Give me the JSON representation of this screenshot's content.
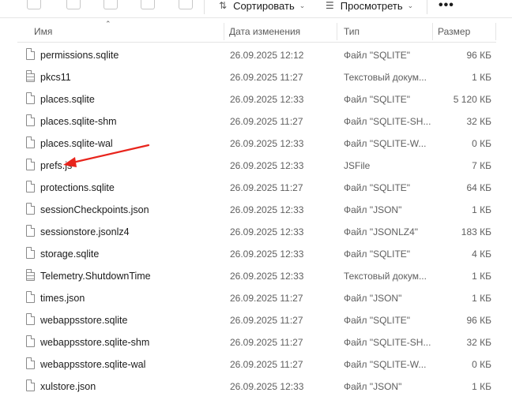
{
  "toolbar": {
    "sort_label": "Сортировать",
    "view_label": "Просмотреть",
    "more_label": "•••"
  },
  "columns": {
    "name": "Имя",
    "date": "Дата изменения",
    "type": "Тип",
    "size": "Размер"
  },
  "files": [
    {
      "name": "permissions.sqlite",
      "date": "26.09.2025 12:12",
      "type": "Файл \"SQLITE\"",
      "size": "96 КБ",
      "icon": "file-icon"
    },
    {
      "name": "pkcs11",
      "date": "26.09.2025 11:27",
      "type": "Текстовый докум...",
      "size": "1 КБ",
      "icon": "text-file-icon"
    },
    {
      "name": "places.sqlite",
      "date": "26.09.2025 12:33",
      "type": "Файл \"SQLITE\"",
      "size": "5 120 КБ",
      "icon": "file-icon"
    },
    {
      "name": "places.sqlite-shm",
      "date": "26.09.2025 11:27",
      "type": "Файл \"SQLITE-SH...",
      "size": "32 КБ",
      "icon": "file-icon"
    },
    {
      "name": "places.sqlite-wal",
      "date": "26.09.2025 12:33",
      "type": "Файл \"SQLITE-W...",
      "size": "0 КБ",
      "icon": "file-icon"
    },
    {
      "name": "prefs.js",
      "date": "26.09.2025 12:33",
      "type": "JSFile",
      "size": "7 КБ",
      "icon": "file-icon"
    },
    {
      "name": "protections.sqlite",
      "date": "26.09.2025 11:27",
      "type": "Файл \"SQLITE\"",
      "size": "64 КБ",
      "icon": "file-icon"
    },
    {
      "name": "sessionCheckpoints.json",
      "date": "26.09.2025 12:33",
      "type": "Файл \"JSON\"",
      "size": "1 КБ",
      "icon": "file-icon"
    },
    {
      "name": "sessionstore.jsonlz4",
      "date": "26.09.2025 12:33",
      "type": "Файл \"JSONLZ4\"",
      "size": "183 КБ",
      "icon": "file-icon"
    },
    {
      "name": "storage.sqlite",
      "date": "26.09.2025 12:33",
      "type": "Файл \"SQLITE\"",
      "size": "4 КБ",
      "icon": "file-icon"
    },
    {
      "name": "Telemetry.ShutdownTime",
      "date": "26.09.2025 12:33",
      "type": "Текстовый докум...",
      "size": "1 КБ",
      "icon": "text-file-icon"
    },
    {
      "name": "times.json",
      "date": "26.09.2025 11:27",
      "type": "Файл \"JSON\"",
      "size": "1 КБ",
      "icon": "file-icon"
    },
    {
      "name": "webappsstore.sqlite",
      "date": "26.09.2025 11:27",
      "type": "Файл \"SQLITE\"",
      "size": "96 КБ",
      "icon": "file-icon"
    },
    {
      "name": "webappsstore.sqlite-shm",
      "date": "26.09.2025 11:27",
      "type": "Файл \"SQLITE-SH...",
      "size": "32 КБ",
      "icon": "file-icon"
    },
    {
      "name": "webappsstore.sqlite-wal",
      "date": "26.09.2025 11:27",
      "type": "Файл \"SQLITE-W...",
      "size": "0 КБ",
      "icon": "file-icon"
    },
    {
      "name": "xulstore.json",
      "date": "26.09.2025 12:33",
      "type": "Файл \"JSON\"",
      "size": "1 КБ",
      "icon": "file-icon"
    }
  ],
  "annotation": {
    "color": "#e8241c",
    "icon": "red-arrow-icon"
  }
}
